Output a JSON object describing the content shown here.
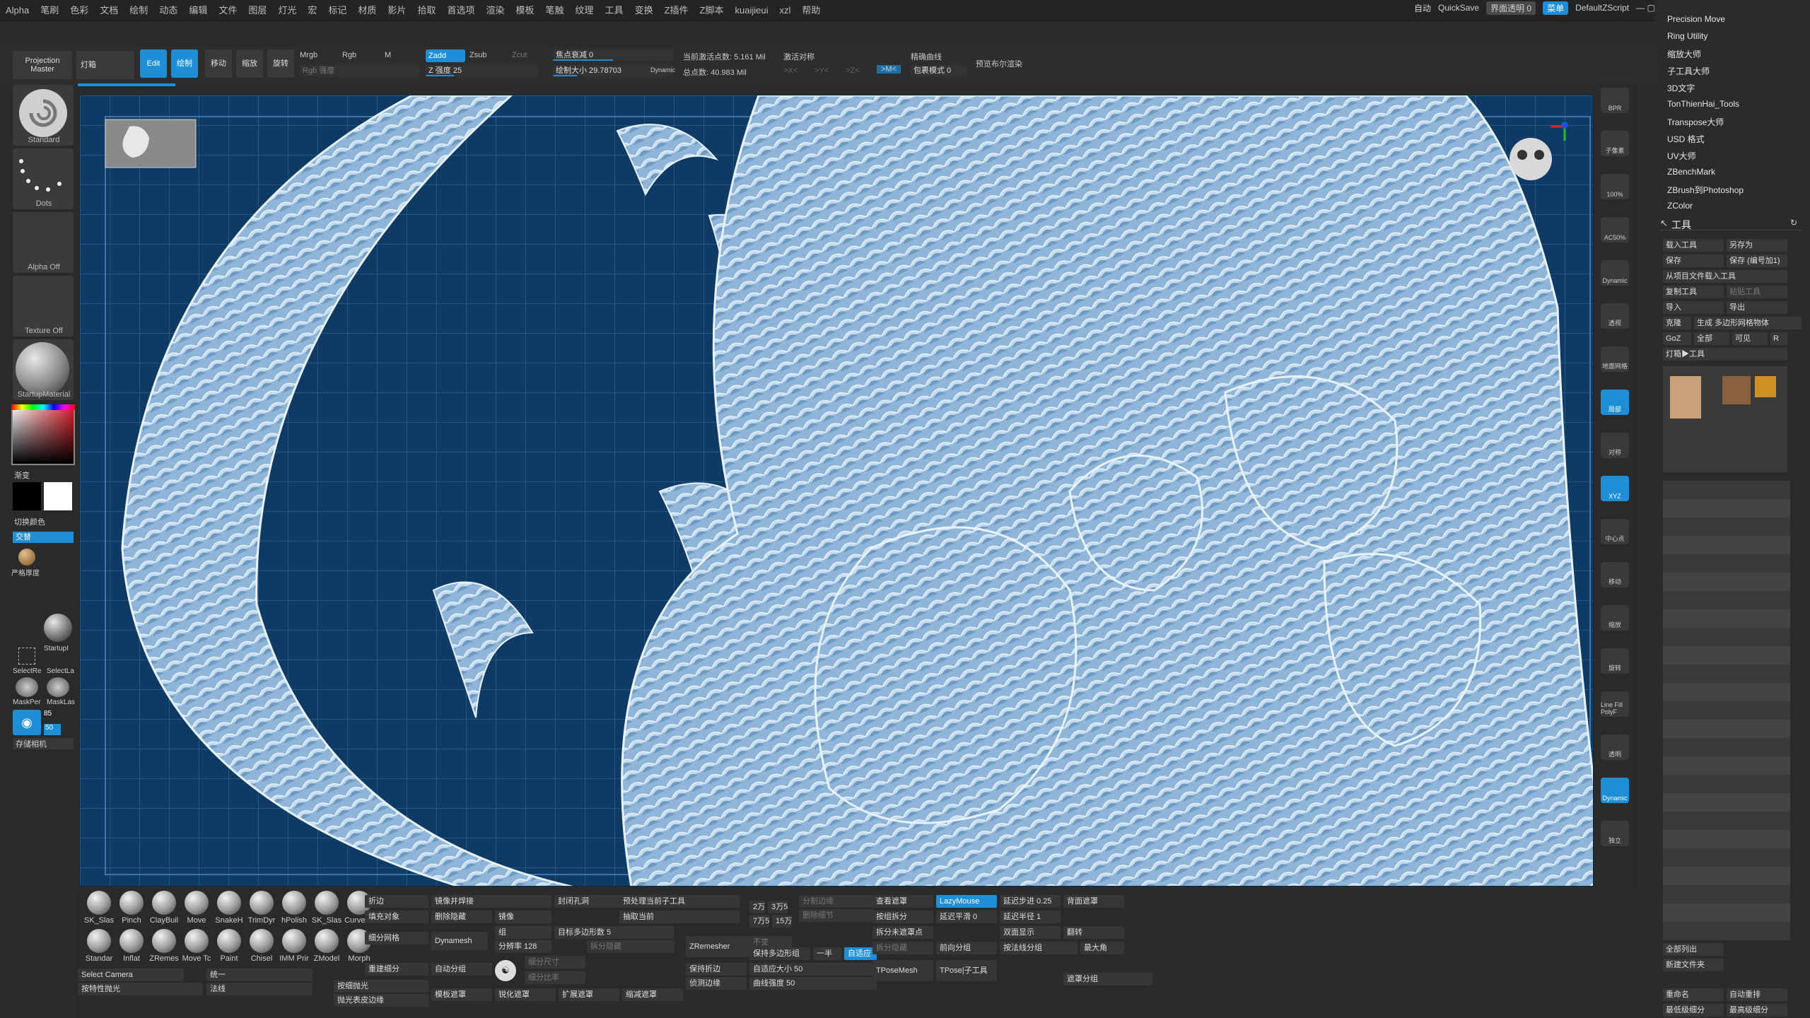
{
  "menu": [
    "Alpha",
    "笔刷",
    "色彩",
    "文档",
    "绘制",
    "动态",
    "编辑",
    "文件",
    "图层",
    "灯光",
    "宏",
    "标记",
    "材质",
    "影片",
    "拾取",
    "首选项",
    "渲染",
    "模板",
    "笔触",
    "纹理",
    "工具",
    "变换",
    "Z插件",
    "Z脚本",
    "kuaijieui",
    "xzl",
    "帮助"
  ],
  "topright": {
    "auto": "自动",
    "quicksave": "QuickSave",
    "ui_opacity": "界面透明 0",
    "menu": "菜单",
    "script": "DefaultZScript"
  },
  "toolbar": {
    "projection_master": "Projection Master",
    "lightbox": "灯箱",
    "edit": "Edit",
    "draw": "绘制",
    "move": "移动",
    "scale": "缩放",
    "rotate": "旋转",
    "mrgb": "Mrgb",
    "rgb": "Rgb",
    "m": "M",
    "rgb_intensity": "Rgb 强度",
    "zadd": "Zadd",
    "zsub": "Zsub",
    "zcut": "Zcut",
    "z_intensity": "Z 强度 25",
    "focal_shift": "焦点衰减 0",
    "draw_size": "绘制大小 29.78703",
    "dynamic": "Dynamic",
    "active_points": "当前激活点数: 5.161 Mil",
    "total_points": "总点数: 40.983 Mil",
    "symmetry": "激活对称",
    "x": ">X<",
    "y": ">Y<",
    "z": ">Z<",
    "m2": ">M<",
    "fine_curve": "精确曲线",
    "envelope_mode": "包裹模式 0",
    "preview_bool": "预览布尔渲染"
  },
  "left": {
    "standard": "Standard",
    "dots": "Dots",
    "alpha_off": "Alpha Off",
    "texture_off": "Texture Off",
    "startup_material": "StartupMaterial",
    "gradient": "渐变",
    "switch_color": "切换颜色",
    "alternate": "交替",
    "strict_thickness": "严格厚度",
    "startup": "StartupI",
    "select_rect": "SelectRe",
    "select_lasso": "SelectLa",
    "mask_pen": "MaskPer",
    "mask_lasso": "MaskLas",
    "cam_num1": "85",
    "cam_num2": "50",
    "save_camera": "存储相机"
  },
  "right_strip": [
    "BPR",
    "子像素",
    "100%",
    "AC50%",
    "Dynamic",
    "透视",
    "地面网格",
    "局部",
    "对称",
    "XYZ",
    "中心点",
    "移动",
    "缩放",
    "旋转",
    "Line Fill PolyF",
    "透明",
    "Dynamic",
    "独立"
  ],
  "plugins": [
    "Precision Move",
    "Ring Utility",
    "缩放大师",
    "子工具大师",
    "3D文字",
    "TonThienHai_Tools",
    "Transpose大师",
    "USD 格式",
    "UV大师",
    "ZBenchMark",
    "ZBrush到Photoshop",
    "ZColor"
  ],
  "tool": {
    "title": "工具",
    "load": "载入工具",
    "save_as": "另存为",
    "save": "保存",
    "save_inc": "保存 (编号加1)",
    "load_from_project": "从项目文件载入工具",
    "copy": "复制工具",
    "paste": "粘贴工具",
    "import": "导入",
    "export": "导出",
    "clone": "克隆",
    "make_polymesh": "生成 多边形网格物体",
    "goz": "GoZ",
    "all": "全部",
    "visible": "可见",
    "r": "R",
    "lightbox_tools": "灯箱▶工具",
    "list_all": "全部列出",
    "new_folder": "新建文件夹",
    "rename": "重命名",
    "auto_reorder": "自动重排",
    "lowest_res": "最低级细分",
    "highest_res": "最高级细分"
  },
  "bottom": {
    "brushes_row1": [
      "SK_Slas",
      "Pinch",
      "ClayBuil",
      "Move",
      "SnakeH",
      "TrimDyr",
      "hPolish",
      "SK_Slas",
      "CurveTu"
    ],
    "brushes_row2": [
      "Standar",
      "Inflat",
      "ZRemes",
      "Move Tc",
      "Paint",
      "Chisel",
      "IMM Prir",
      "ZModel",
      "Morph"
    ],
    "select_camera": "Select Camera",
    "unify": "统一",
    "smooth_by_feature": "按特性抛光",
    "normal": "法线",
    "crease": "折边",
    "fill_object": "填充对象",
    "subdiv_mesh": "细分网格",
    "rebuild_subdiv": "重建细分",
    "subdiv_smooth": "按细抛光",
    "smooth_subdiv_edge": "抛光表皮边缘",
    "mirror_weld": "镜像并焊接",
    "del_hidden": "删除隐藏",
    "mirror": "镜像",
    "dynamesh": "Dynamesh",
    "auto_group": "自动分组",
    "template_mask": "模板遮罩",
    "close_holes": "封闭孔洞",
    "group_by_count": "组",
    "target_poly": "目标多边形数 5",
    "group_split": "拆分隐藏",
    "resolution": "分辨率 128",
    "subdiv_size": "细分尺寸",
    "subdiv_ratio": "细分比率",
    "sharpen_mask": "锐化遮罩",
    "expand_mask": "扩展遮罩",
    "shrink_mask": "缩减遮罩",
    "preview_current": "预处理当前子工具",
    "extract_current": "抽取当前",
    "zremesher": "ZRemesher",
    "keep_creases": "保持折边",
    "detect_edges": "侦测边缘",
    "keep_groups": "保持多边形组",
    "half": "一半",
    "adaptive": "自适应",
    "same": "不变",
    "adaptive_size": "自适应大小 50",
    "curve_strength": "曲线强度 50",
    "k2": "2万",
    "k35": "3万5",
    "k75": "7万5",
    "k15": "15万",
    "view_mask": "查看遮罩",
    "lazymouse": "LazyMouse",
    "lazystep": "延迟步进 0.25",
    "back_mask": "背面遮罩",
    "split_by_groups": "按组拆分",
    "lazysmooth": "延迟平滑 0",
    "lazyradius": "延迟半径 1",
    "split_unmasked": "拆分未遮罩点",
    "double_sided": "双面显示",
    "flip": "翻转",
    "split_hidden": "拆分隐藏",
    "group_front": "前向分组",
    "group_by_normal": "按法线分组",
    "max_angle": "最大角",
    "tpose_mesh": "TPoseMesh",
    "tpose_subtool": "TPose|子工具",
    "mask_group": "遮罩分组",
    "subdiv_edge": "分割边缘",
    "del_edge": "删除细节"
  },
  "colors": {
    "accent": "#1e8fd6",
    "viewport": "#0f3a63",
    "grid": "#2c6a9a",
    "fur": "#a8c8e4"
  }
}
